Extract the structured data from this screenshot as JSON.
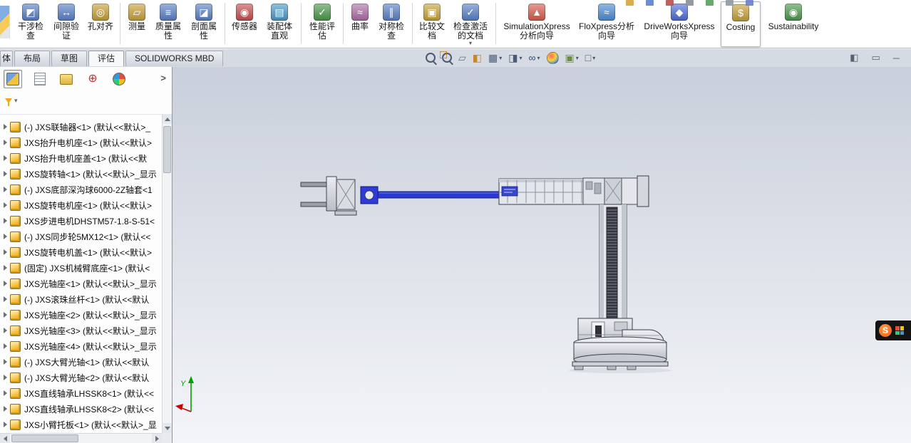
{
  "menubar": {
    "icons": [
      {
        "name": "menubar-icon-1",
        "color": "#d9a33b"
      },
      {
        "name": "menubar-icon-2",
        "color": "#5b82c9"
      },
      {
        "name": "menubar-icon-3",
        "color": "#b8514d"
      },
      {
        "name": "menubar-icon-4",
        "color": "#8a8f98"
      },
      {
        "name": "menubar-icon-5",
        "color": "#57a05a"
      },
      {
        "name": "menubar-icon-6",
        "color": "#9098a3"
      },
      {
        "name": "menubar-icon-7",
        "color": "#6a7ecb"
      }
    ]
  },
  "ribbon": {
    "items": [
      {
        "id": "interference-check",
        "label": "干涉检查",
        "icon": "interference-check-icon",
        "glyph": "◩",
        "color": "#5b82c9"
      },
      {
        "id": "clearance-verification",
        "label": "间隙验证",
        "icon": "clearance-verification-icon",
        "glyph": "↔",
        "color": "#5b82c9"
      },
      {
        "id": "hole-alignment",
        "label": "孔对齐",
        "icon": "hole-alignment-icon",
        "glyph": "◎",
        "color": "#c9a23b"
      },
      {
        "type": "separator"
      },
      {
        "id": "measure",
        "label": "测量",
        "icon": "measure-icon",
        "glyph": "▱",
        "color": "#caa53d"
      },
      {
        "id": "mass-properties",
        "label": "质量属性",
        "icon": "mass-properties-icon",
        "glyph": "≡",
        "color": "#5b82c9"
      },
      {
        "id": "section-properties",
        "label": "剖面属性",
        "icon": "section-properties-icon",
        "glyph": "◪",
        "color": "#5b82c9"
      },
      {
        "type": "separator"
      },
      {
        "id": "sensor",
        "label": "传感器",
        "icon": "sensor-icon",
        "glyph": "◉",
        "color": "#c94f4f"
      },
      {
        "id": "assembly-visualization",
        "label": "装配体直观",
        "icon": "assembly-visualization-icon",
        "glyph": "▤",
        "color": "#4f9ac9"
      },
      {
        "type": "separator"
      },
      {
        "id": "performance-evaluation",
        "label": "性能评估",
        "icon": "performance-evaluation-icon",
        "glyph": "✓",
        "color": "#4e9a4e"
      },
      {
        "type": "separator"
      },
      {
        "id": "curvature",
        "label": "曲率",
        "icon": "curvature-icon",
        "glyph": "≈",
        "color": "#b06fa8"
      },
      {
        "id": "symmetry-check",
        "label": "对称检查",
        "icon": "symmetry-check-icon",
        "glyph": "∥",
        "color": "#5b82c9"
      },
      {
        "type": "separator"
      },
      {
        "id": "compare-documents",
        "label": "比较文档",
        "icon": "compare-documents-icon",
        "glyph": "▣",
        "color": "#caa53d"
      },
      {
        "id": "check-active-document",
        "label": "检查激活的文档",
        "icon": "check-active-document-icon",
        "glyph": "✓",
        "color": "#5b82c9",
        "dropdown": true
      },
      {
        "type": "separator"
      },
      {
        "id": "simulationxpress-wizard",
        "label": "SimulationXpress分析向导",
        "icon": "simulationxpress-icon",
        "glyph": "▲",
        "color": "#d95f4f"
      },
      {
        "id": "floxpress-wizard",
        "label": "FloXpress分析向导",
        "icon": "floxpress-icon",
        "glyph": "≈",
        "color": "#4f8ed9"
      },
      {
        "id": "driveworksxpress-wizard",
        "label": "DriveWorksXpress向导",
        "icon": "driveworksxpress-icon",
        "glyph": "◆",
        "color": "#4f6fd9"
      },
      {
        "id": "costing",
        "label": "Costing",
        "icon": "costing-icon",
        "glyph": "$",
        "color": "#c9a23b",
        "active": true
      },
      {
        "id": "sustainability",
        "label": "Sustainability",
        "icon": "sustainability-icon",
        "glyph": "◉",
        "color": "#4e9a4e"
      }
    ]
  },
  "command_tabs": {
    "items": [
      {
        "label": "体",
        "cut": true
      },
      {
        "label": "布局"
      },
      {
        "label": "草图"
      },
      {
        "label": "评估",
        "active": true
      },
      {
        "label": "SOLIDWORKS MBD"
      }
    ]
  },
  "viewport_toolbar": {
    "icons": [
      {
        "name": "zoom-to-fit-icon",
        "kind": "mag"
      },
      {
        "name": "zoom-to-area-icon",
        "kind": "mag-area"
      },
      {
        "name": "previous-view-icon",
        "kind": "glyph",
        "glyph": "▱",
        "color": "#6a7283"
      },
      {
        "name": "section-view-icon",
        "kind": "glyph",
        "glyph": "◧",
        "color": "#c9872a"
      },
      {
        "name": "view-orientation-icon",
        "kind": "glyph",
        "glyph": "▦",
        "color": "#4a5a74",
        "dropdown": true
      },
      {
        "name": "display-style-icon",
        "kind": "glyph",
        "glyph": "◨",
        "color": "#4a5a74",
        "dropdown": true
      },
      {
        "name": "hide-show-items-icon",
        "kind": "glyph",
        "glyph": "∞",
        "color": "#35507a",
        "dropdown": true
      },
      {
        "name": "edit-appearance-icon",
        "kind": "ball"
      },
      {
        "name": "apply-scene-icon",
        "kind": "glyph",
        "glyph": "▣",
        "color": "#6a8f3c",
        "dropdown": true
      },
      {
        "name": "view-settings-icon",
        "kind": "glyph",
        "glyph": "□",
        "color": "#4a5a74",
        "dropdown": true
      }
    ]
  },
  "dock_icons": [
    {
      "name": "pane-split-icon",
      "glyph": "◧"
    },
    {
      "name": "pane-float-icon",
      "glyph": "▭"
    },
    {
      "name": "collapse-ribbon-icon",
      "glyph": "─"
    }
  ],
  "feature_panel": {
    "flyout_glyph": ">",
    "manager_tabs": [
      {
        "name": "featuremanager-tab",
        "kind": "fm",
        "active": true
      },
      {
        "name": "propertymanager-tab",
        "kind": "pm"
      },
      {
        "name": "configurationmanager-tab",
        "kind": "cm"
      },
      {
        "name": "dimxpertmanager-tab",
        "kind": "dx",
        "glyph": "⊕"
      },
      {
        "name": "displaymanager-tab",
        "kind": "dm"
      }
    ],
    "items": [
      {
        "text": "(-) JXS联轴器<1> (默认<<默认>_"
      },
      {
        "text": "JXS抬升电机座<1> (默认<<默认>"
      },
      {
        "text": "JXS抬升电机座盖<1> (默认<<默"
      },
      {
        "text": "JXS旋转轴<1> (默认<<默认>_显示"
      },
      {
        "text": "(-) JXS底部深沟球6000-2Z轴套<1"
      },
      {
        "text": "JXS旋转电机座<1> (默认<<默认>"
      },
      {
        "text": "JXS步进电机DHSTM57-1.8-S-51<"
      },
      {
        "text": "(-) JXS同步轮5MX12<1> (默认<<"
      },
      {
        "text": "JXS旋转电机盖<1> (默认<<默认>"
      },
      {
        "text": "(固定) JXS机械臂底座<1> (默认<"
      },
      {
        "text": "JXS光轴座<1> (默认<<默认>_显示"
      },
      {
        "text": "(-) JXS滚珠丝杆<1> (默认<<默认"
      },
      {
        "text": "JXS光轴座<2> (默认<<默认>_显示"
      },
      {
        "text": "JXS光轴座<3> (默认<<默认>_显示"
      },
      {
        "text": "JXS光轴座<4> (默认<<默认>_显示"
      },
      {
        "text": "(-) JXS大臂光轴<1> (默认<<默认"
      },
      {
        "text": "(-) JXS大臂光轴<2> (默认<<默认"
      },
      {
        "text": "JXS直线轴承LHSSK8<1> (默认<<"
      },
      {
        "text": "JXS直线轴承LHSSK8<2> (默认<<"
      },
      {
        "text": "JXS小臂托板<1> (默认<<默认>_显"
      }
    ]
  },
  "triad": {
    "y_label": "Y"
  },
  "ime_bar": {
    "label": "S"
  }
}
